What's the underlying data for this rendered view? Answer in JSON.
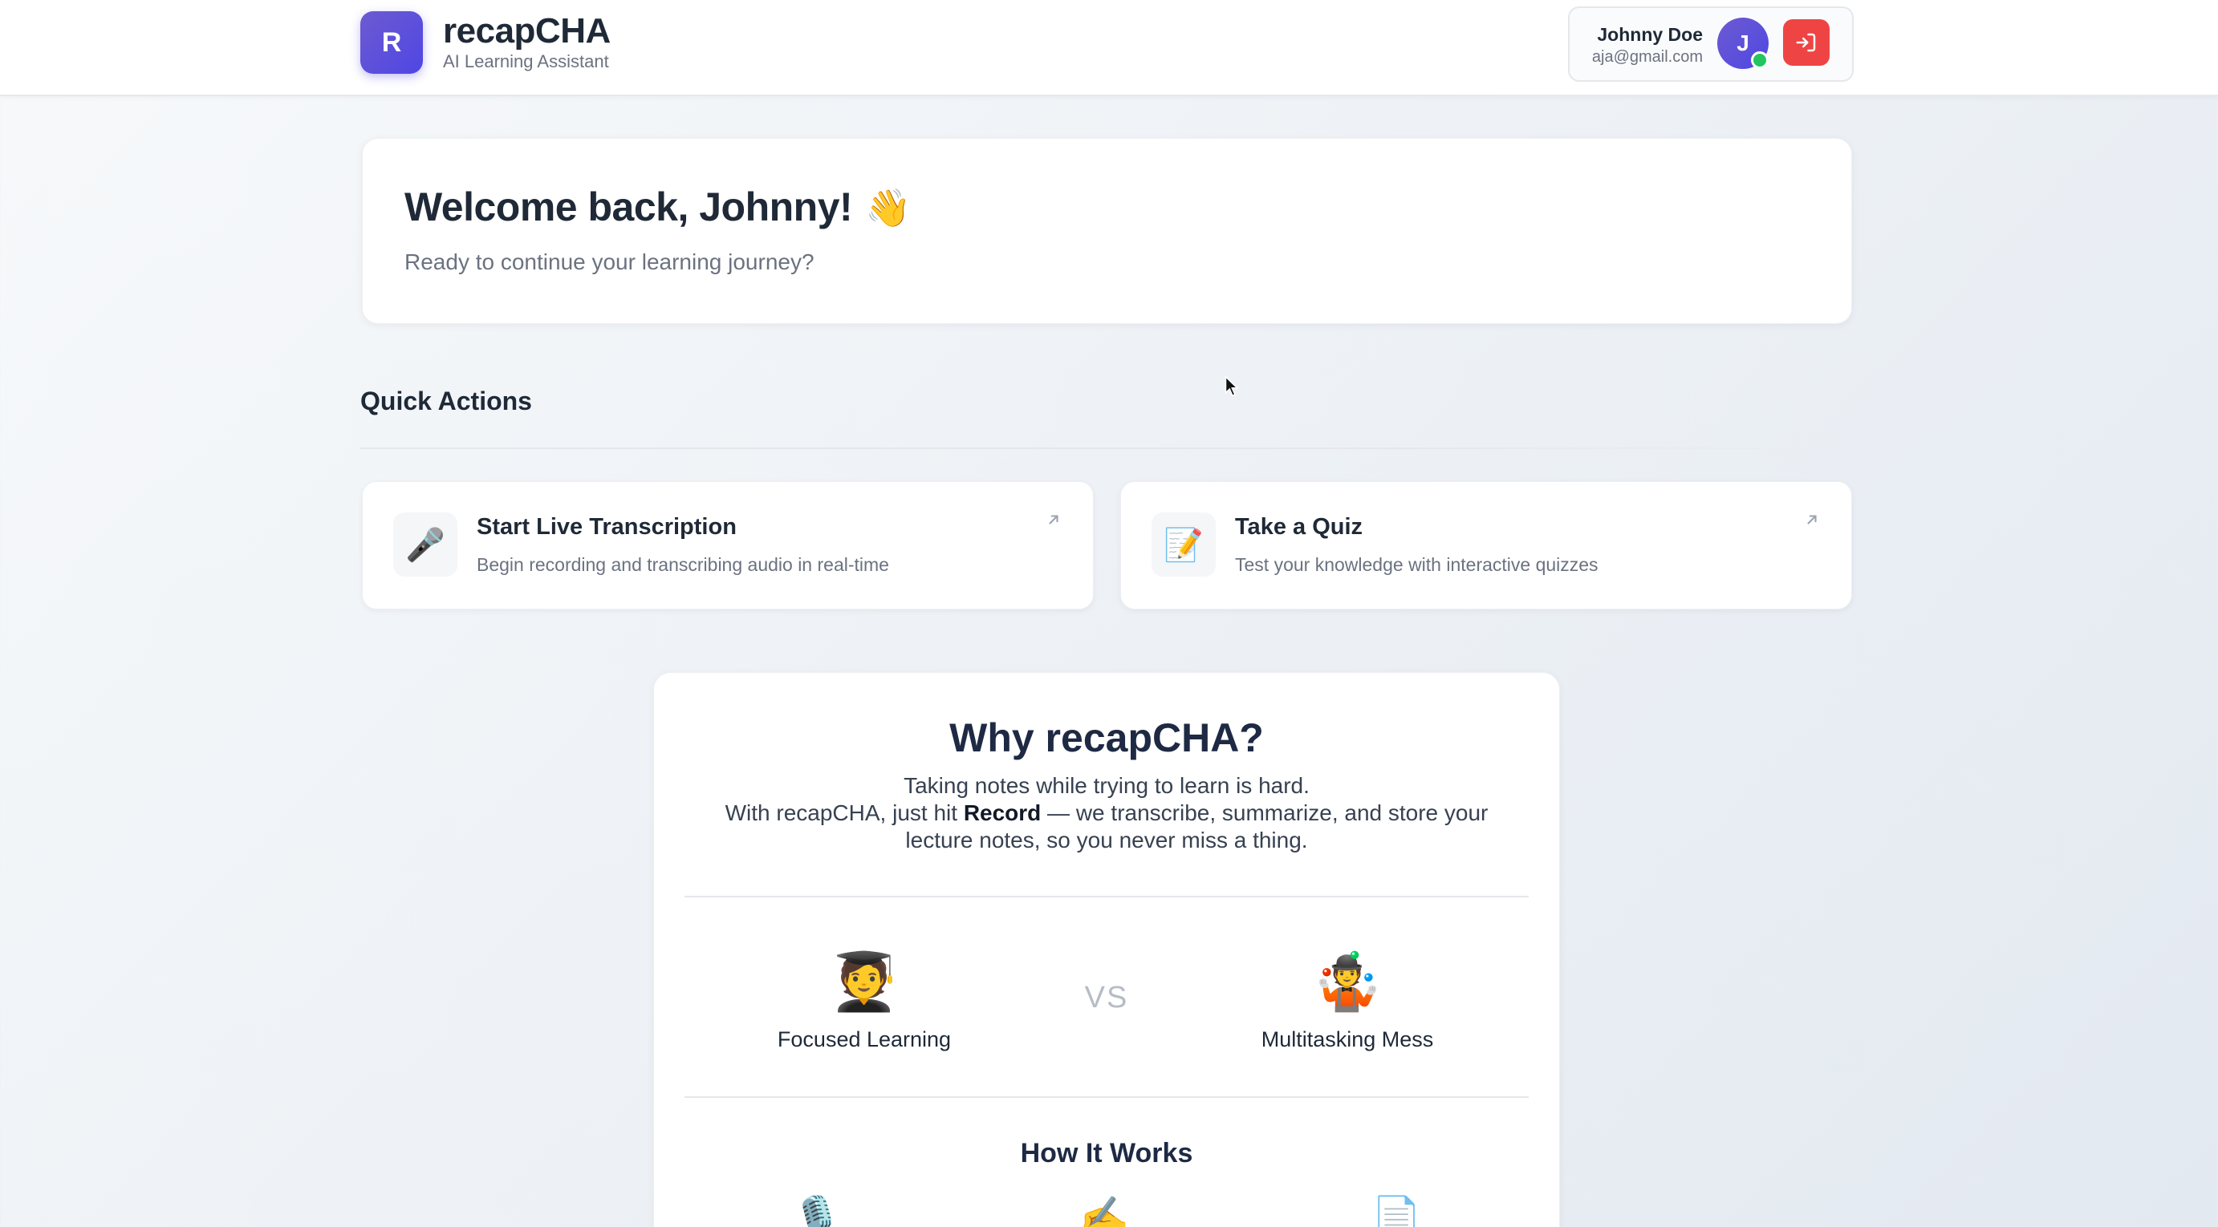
{
  "header": {
    "logo_letter": "R",
    "app_name": "recapCHA",
    "tagline": "AI Learning Assistant",
    "user": {
      "name": "Johnny Doe",
      "email": "aja@gmail.com",
      "avatar_initial": "J",
      "online_status_color": "#22c55e"
    },
    "logout_icon": "logout-icon",
    "accent_color": "#4f46e5",
    "logout_color": "#ef4444"
  },
  "welcome": {
    "title": "Welcome back, Johnny!",
    "emoji": "👋",
    "subtitle": "Ready to continue your learning journey?"
  },
  "quick_actions": {
    "heading": "Quick Actions",
    "items": [
      {
        "icon": "🎤",
        "icon_name": "microphone-icon",
        "title": "Start Live Transcription",
        "description": "Begin recording and transcribing audio in real-time"
      },
      {
        "icon": "📝",
        "icon_name": "memo-icon",
        "title": "Take a Quiz",
        "description": "Test your knowledge with interactive quizzes"
      }
    ]
  },
  "why": {
    "title": "Why recapCHA?",
    "line1": "Taking notes while trying to learn is hard.",
    "line2_prefix": "With recapCHA, just hit ",
    "line2_bold": "Record",
    "line2_suffix": " — we transcribe, summarize, and store your lecture notes, so you never miss a thing.",
    "compare_left": {
      "emoji": "🧑‍🎓",
      "label": "Focused Learning"
    },
    "vs": "VS",
    "compare_right": {
      "emoji": "🤹",
      "label": "Multitasking Mess"
    },
    "how_title": "How It Works",
    "how_icons": [
      "🎙️",
      "✍️",
      "📄"
    ]
  }
}
